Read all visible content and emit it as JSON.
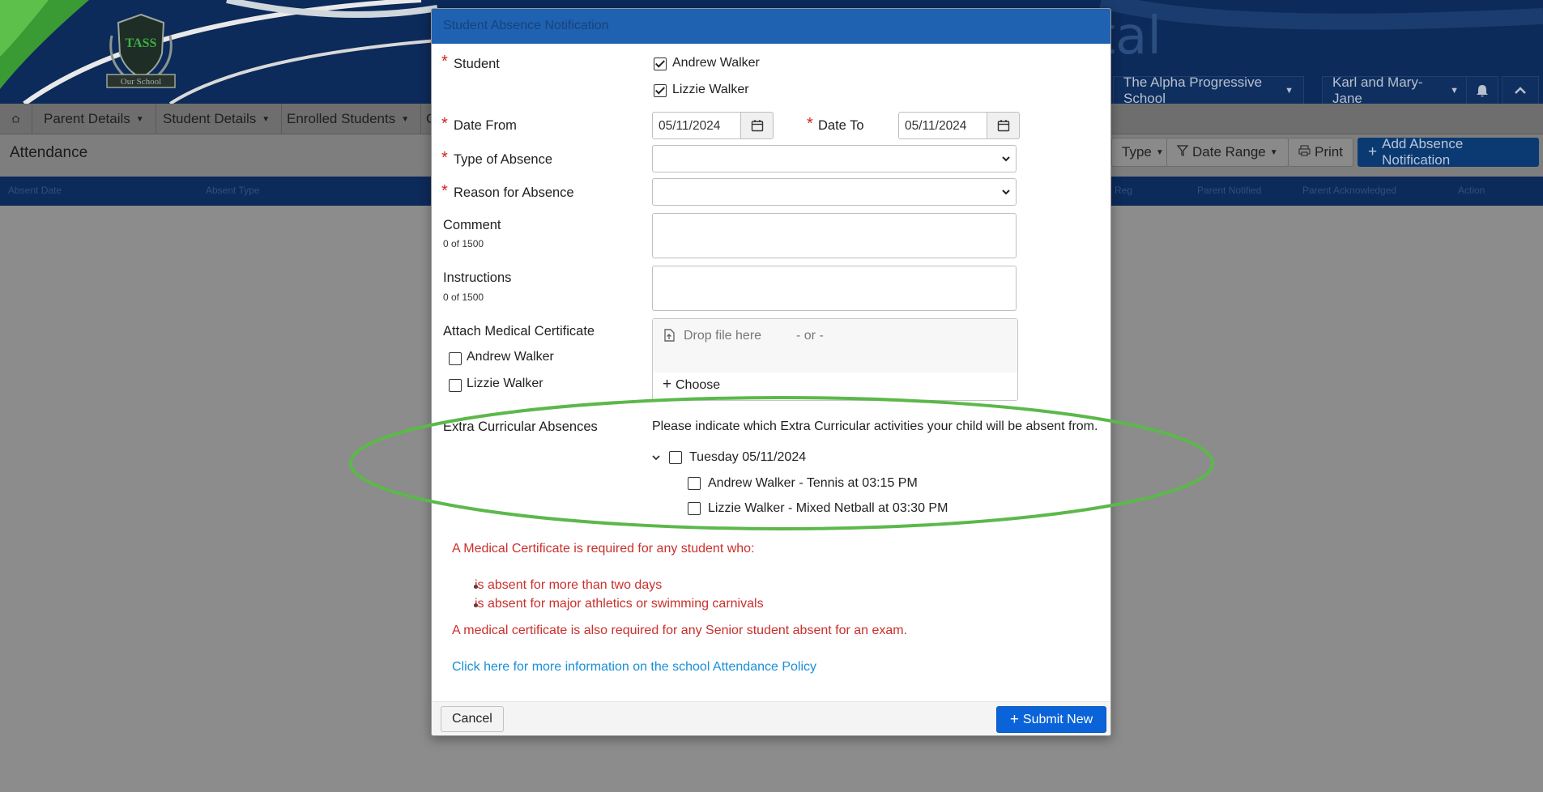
{
  "header": {
    "logo_text": "TASS",
    "logo_banner": "Our School",
    "portal_text_partial": "tal",
    "school_selector": "The Alpha Progressive School",
    "user_selector": "Karl and Mary-Jane"
  },
  "nav": {
    "items": [
      "Parent Details",
      "Student Details",
      "Enrolled Students",
      "C"
    ]
  },
  "page": {
    "title": "Attendance",
    "filters": [
      "Type",
      "Date Range"
    ],
    "print_label": "Print",
    "add_label": "Add Absence Notification",
    "table_columns": [
      "Absent Date",
      "Absent Type",
      "Reg",
      "Parent Notified",
      "Parent Acknowledged",
      "Action"
    ]
  },
  "modal": {
    "title": "Student Absence Notification",
    "student_label": "Student",
    "students": [
      {
        "name": "Andrew Walker",
        "checked": true
      },
      {
        "name": "Lizzie Walker",
        "checked": true
      }
    ],
    "date_from_label": "Date From",
    "date_from_value": "05/11/2024",
    "date_to_label": "Date To",
    "date_to_value": "05/11/2024",
    "type_label": "Type of Absence",
    "reason_label": "Reason for Absence",
    "comment_label": "Comment",
    "comment_count": "0 of 1500",
    "instructions_label": "Instructions",
    "instructions_count": "0 of 1500",
    "attach_label": "Attach Medical Certificate",
    "attach_students": [
      {
        "name": "Andrew Walker",
        "checked": false
      },
      {
        "name": "Lizzie Walker",
        "checked": false
      }
    ],
    "dropzone_text": "Drop file here",
    "dropzone_or": "- or -",
    "choose_label": "Choose",
    "extra_label": "Extra Curricular Absences",
    "extra_instruction": "Please indicate which Extra Curricular activities your child will be absent from.",
    "extra_day": "Tuesday 05/11/2024",
    "extra_items": [
      "Andrew Walker - Tennis at 03:15 PM",
      "Lizzie Walker - Mixed Netball at 03:30 PM"
    ],
    "medical_notice": "A Medical Certificate is required for any student who:",
    "medical_bullets": [
      "is absent for more than two days",
      "is absent for major athletics or swimming carnivals"
    ],
    "senior_notice": "A medical certificate is also required for any Senior student absent for an exam.",
    "policy_link": "Click here for more information on the school Attendance Policy",
    "cancel_label": "Cancel",
    "submit_label": "Submit New"
  },
  "colors": {
    "modal_header": "#1f62b1",
    "required": "#d62020",
    "notice_red": "#c9302c",
    "link": "#1a8fd6",
    "submit": "#0a63d9",
    "highlight_ellipse": "#5cb84a"
  }
}
